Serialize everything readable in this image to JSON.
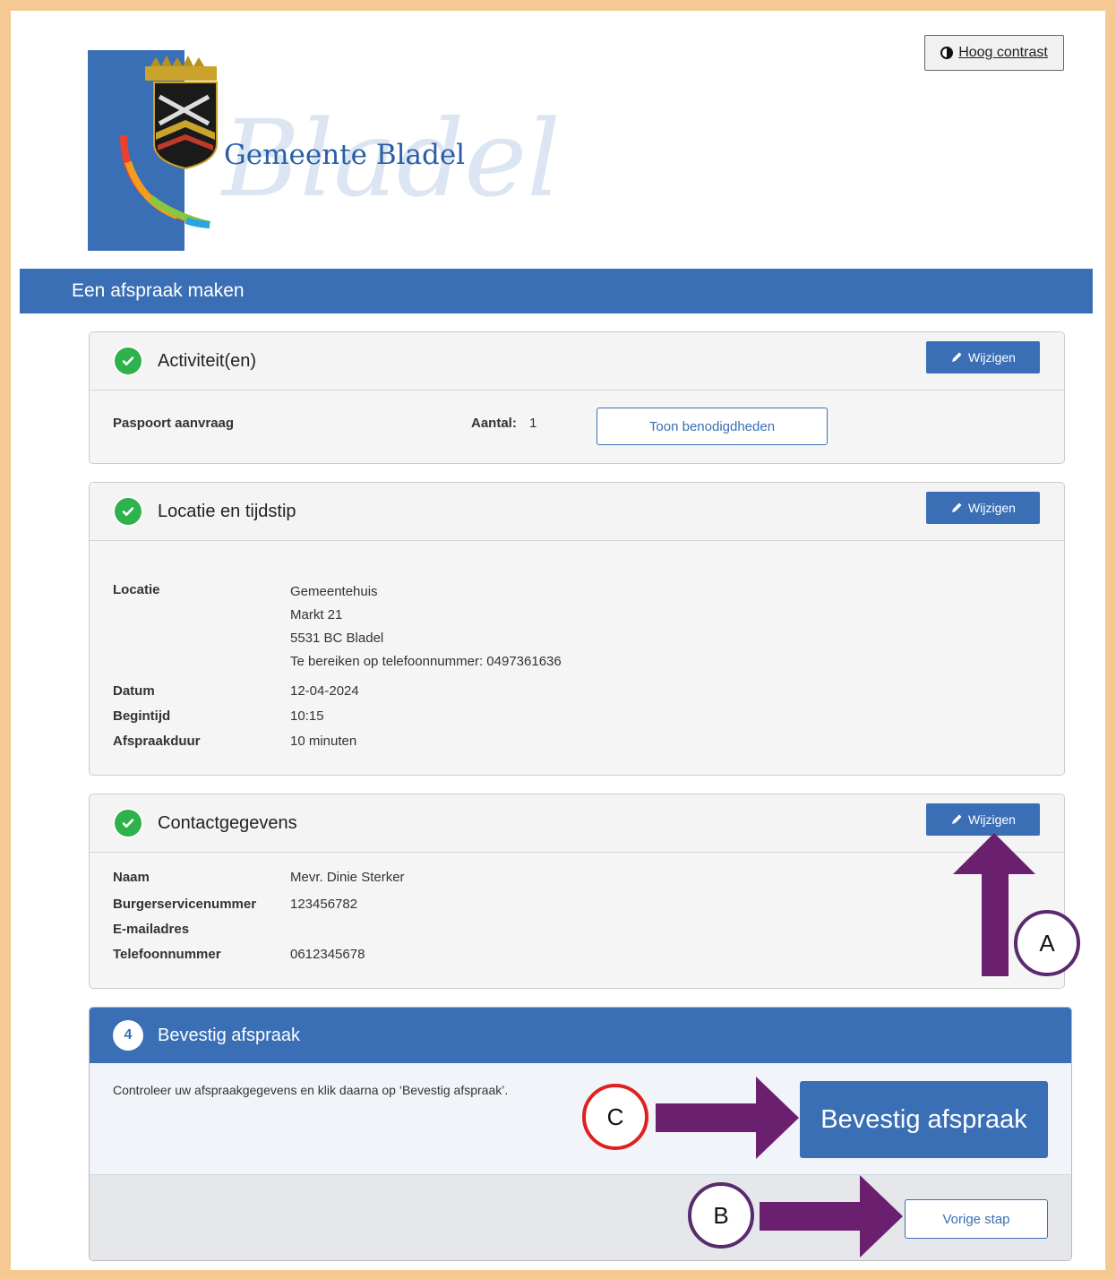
{
  "header": {
    "logo_title": "Gemeente Bladel",
    "logo_watermark": "Bladel",
    "contrast_label": "Hoog contrast"
  },
  "banner": {
    "title": "Een afspraak maken"
  },
  "activities": {
    "title": "Activiteit(en)",
    "edit_label": "Wijzigen",
    "item": "Paspoort aanvraag",
    "count_label": "Aantal:",
    "count_value": "1",
    "show_button": "Toon benodigdheden"
  },
  "location": {
    "title": "Locatie en tijdstip",
    "edit_label": "Wijzigen",
    "location_label": "Locatie",
    "location_name": "Gemeentehuis",
    "street": "Markt 21",
    "city": "5531 BC Bladel",
    "phone_line": "Te bereiken op telefoonnummer: 0497361636",
    "date_label": "Datum",
    "date_value": "12-04-2024",
    "start_label": "Begintijd",
    "start_value": "10:15",
    "duration_label": "Afspraakduur",
    "duration_value": "10 minuten"
  },
  "contact": {
    "title": "Contactgegevens",
    "edit_label": "Wijzigen",
    "name_label": "Naam",
    "name_value": "Mevr. Dinie Sterker",
    "bsn_label": "Burgerservicenummer",
    "bsn_value": "123456782",
    "email_label": "E-mailadres",
    "email_value": "",
    "phone_label": "Telefoonnummer",
    "phone_value": "0612345678"
  },
  "confirm": {
    "step": "4",
    "title": "Bevestig afspraak",
    "instruction": "Controleer uw afspraakgegevens en klik daarna op ‘Bevestig afspraak’.",
    "confirm_button": "Bevestig afspraak",
    "previous_button": "Vorige stap"
  },
  "annotations": {
    "a": "A",
    "b": "B",
    "c": "C",
    "arrow_color": "#6b1f6f",
    "circle_color_ab": "#5a2a6e",
    "circle_color_c": "#e02020"
  },
  "colors": {
    "brand_blue": "#3a6fb5",
    "success_green": "#2eb24b",
    "frame": "#f6c992"
  }
}
